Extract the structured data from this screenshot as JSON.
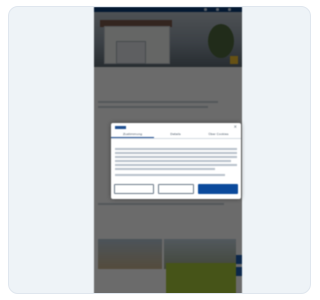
{
  "page": {
    "hero_badge": "",
    "breadcrumb": "",
    "heading_start": "",
    "heading_accent": "",
    "subheading": "",
    "section_heading": ""
  },
  "consent_dialog": {
    "tabs": [
      {
        "label": "Zustimmung"
      },
      {
        "label": "Details"
      },
      {
        "label": "Über Cookies"
      }
    ],
    "heading": "",
    "close_symbol": "×",
    "buttons": {
      "select_label": "",
      "reject_label": "",
      "accept_label": ""
    }
  },
  "colors": {
    "brand": "#0b3c78",
    "accent": "#0b4a9c",
    "badge": "#f2c230",
    "promo": "#a7c83a"
  }
}
